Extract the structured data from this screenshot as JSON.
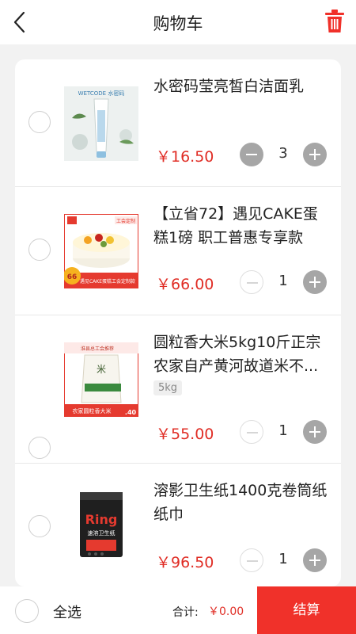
{
  "header": {
    "title": "购物车"
  },
  "items": [
    {
      "name": "水密码莹亮皙白洁面乳",
      "spec": "",
      "price": "￥16.50",
      "qty": "3"
    },
    {
      "name": "【立省72】遇见CAKE蛋糕1磅 职工普惠专享款",
      "spec": "",
      "price": "￥66.00",
      "qty": "1"
    },
    {
      "name": "圆粒香大米5kg10斤正宗农家自产黄河故道米不...",
      "spec": "5kg",
      "price": "￥55.00",
      "qty": "1"
    },
    {
      "name": "溶影卫生纸1400克卷筒纸 纸巾",
      "spec": "",
      "price": "￥96.50",
      "qty": "1"
    }
  ],
  "thumb_text": {
    "cleanser_brand": "WETCODE 水密码",
    "cake_badge": "工会定制",
    "cake_price": "66",
    "cake_caption": "遇见CAKE蛋糕工会定制款",
    "rice_banner": "淮县总工会推荐",
    "rice_bag": "米",
    "rice_caption": "农家圆粒香大米",
    "rice_price": ".40",
    "tissue_brand": "Ring",
    "tissue_caption": "速溶卫生纸"
  },
  "footer": {
    "select_all": "全选",
    "total_label": "合计:",
    "total_value": "￥0.00",
    "checkout": "结算"
  },
  "colors": {
    "accent": "#f0312a",
    "price": "#e02d25"
  }
}
